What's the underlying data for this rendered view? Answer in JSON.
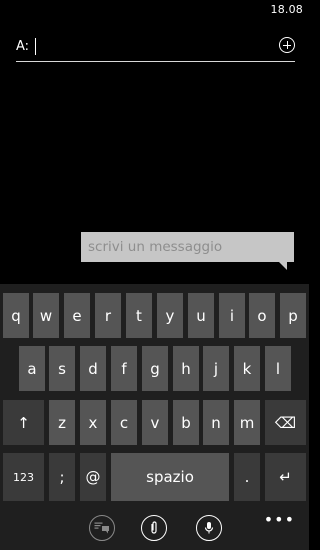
{
  "status": {
    "time": "18.08"
  },
  "recipient": {
    "label": "A:",
    "value": ""
  },
  "compose": {
    "placeholder": "scrivi un messaggio"
  },
  "keyboard": {
    "row1": [
      "q",
      "w",
      "e",
      "r",
      "t",
      "y",
      "u",
      "i",
      "o",
      "p"
    ],
    "row2": [
      "a",
      "s",
      "d",
      "f",
      "g",
      "h",
      "j",
      "k",
      "l"
    ],
    "row3": [
      "z",
      "x",
      "c",
      "v",
      "b",
      "n",
      "m"
    ],
    "shift": "↑",
    "backspace": "⌫",
    "numbers": "123",
    "semicolon": ";",
    "at": "@",
    "space": "spazio",
    "period": ".",
    "enter": "↵"
  },
  "appbar": {
    "icons": [
      "chat-switch-icon",
      "attach-icon",
      "microphone-icon"
    ],
    "more": "•••"
  }
}
